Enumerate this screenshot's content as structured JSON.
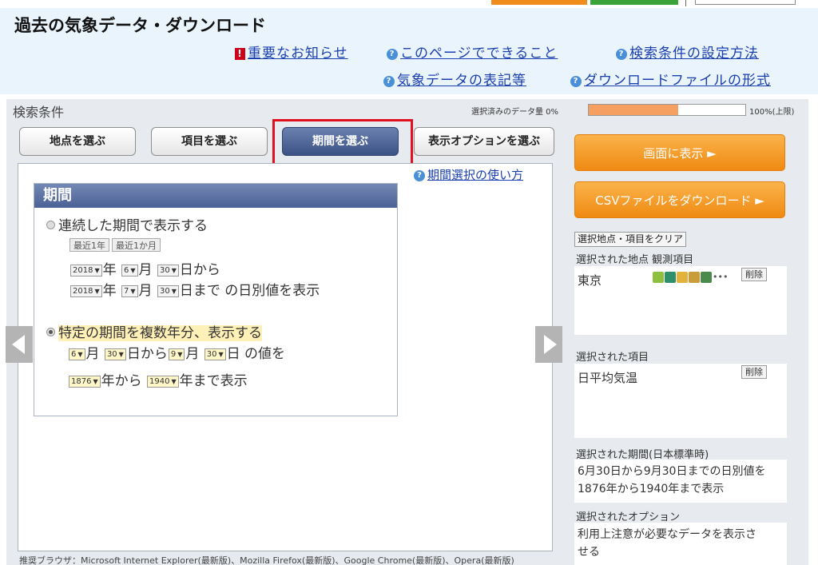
{
  "header": {
    "title": "過去の気象データ・ダウンロード",
    "links": {
      "notice": "重要なお知らせ",
      "about": "このページでできること",
      "how_to": "検索条件の設定方法",
      "notation": "気象データの表記等",
      "format": "ダウンロードファイルの形式"
    }
  },
  "search": {
    "label": "検索条件",
    "amount_label": "選択済みのデータ量 0%",
    "amount_max": "100%(上限)",
    "amount_fraction": 0.57
  },
  "tabs": {
    "station": "地点を選ぶ",
    "item": "項目を選ぶ",
    "period": "期間を選ぶ",
    "options": "表示オプションを選ぶ"
  },
  "period": {
    "help_link": "期間選択の使い方",
    "header": "期間",
    "continuous": {
      "label": "連続した期間で表示する",
      "btn_1y": "最近1年",
      "btn_1m": "最近1か月",
      "start_year": "2018",
      "start_month": "6",
      "start_day": "30",
      "end_year": "2018",
      "end_month": "7",
      "end_day": "30",
      "year_unit": "年",
      "month_unit": "月",
      "from_text": "日から",
      "to_text": "日まで の日別値を表示"
    },
    "multiyear": {
      "label": "特定の期間を複数年分、表示する",
      "start_month": "6",
      "start_day": "30",
      "end_month": "9",
      "end_day": "30",
      "start_year": "1876",
      "end_year": "1940",
      "month_unit": "月",
      "day_from": "日から",
      "day_value": "日 の値を",
      "year_from": "年から",
      "year_to": "年まで表示"
    }
  },
  "right": {
    "show_button": "画面に表示 ►",
    "csv_button": "CSVファイルをダウンロード ►",
    "clear_button": "選択地点・項目をクリア",
    "station_label": "選択された地点 観測項目",
    "station_value": "東京",
    "delete_label": "削除",
    "item_label": "選択された項目",
    "item_value": "日平均気温",
    "period_label": "選択された期間(日本標準時)",
    "period_line1": "6月30日から9月30日までの日別値を",
    "period_line2": "1876年から1940年まで表示",
    "option_label": "選択されたオプション",
    "option_line1": "利用上注意が必要なデータを表示さ",
    "option_line2": "せる"
  },
  "footer": "推奨ブラウザ：Microsoft Internet Explorer(最新版)、Mozilla Firefox(最新版)、Google Chrome(最新版)、Opera(最新版)",
  "colors": {
    "accent_orange": "#ef8a12",
    "tab_active": "#3c5285",
    "highlight": "#e0101e",
    "link": "#1b3faf"
  }
}
